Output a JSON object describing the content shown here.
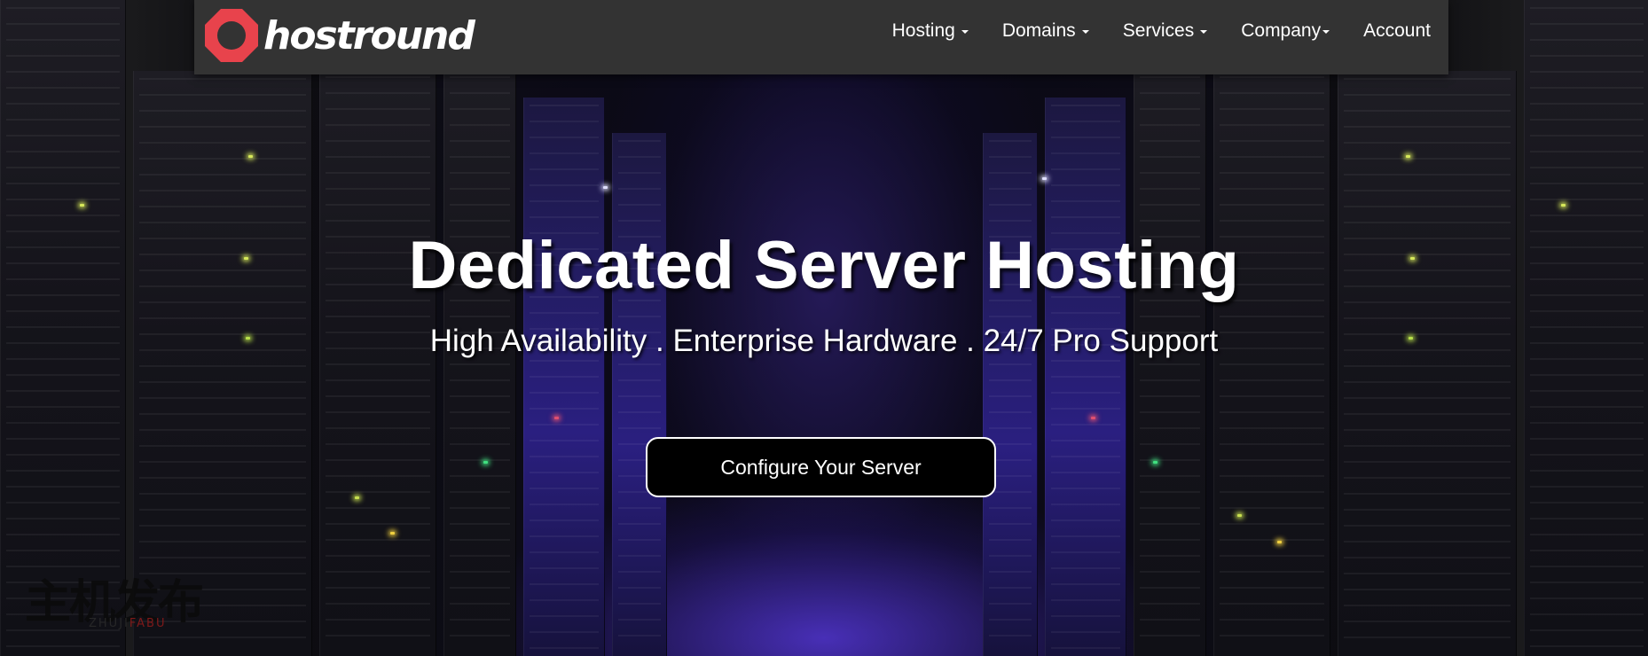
{
  "navbar": {
    "logo_text": "hostround",
    "logo_icon": "octagon-ring-icon",
    "brand_color": "#e8434c",
    "background": "#333333",
    "items": [
      {
        "label": "Hosting",
        "has_dropdown": true
      },
      {
        "label": "Domains",
        "has_dropdown": true
      },
      {
        "label": "Services",
        "has_dropdown": true
      },
      {
        "label": "Company",
        "has_dropdown": true
      },
      {
        "label": "Account",
        "has_dropdown": false
      }
    ]
  },
  "hero": {
    "title": "Dedicated Server Hosting",
    "subtitle": "High Availability . Enterprise Hardware . 24/7 Pro Support",
    "cta_label": "Configure Your Server",
    "background_icon": "datacenter-server-aisle-photo"
  },
  "watermark": {
    "text_cn": "主机发布",
    "text_en_a": "ZHUJI",
    "text_en_b": "FABU"
  }
}
